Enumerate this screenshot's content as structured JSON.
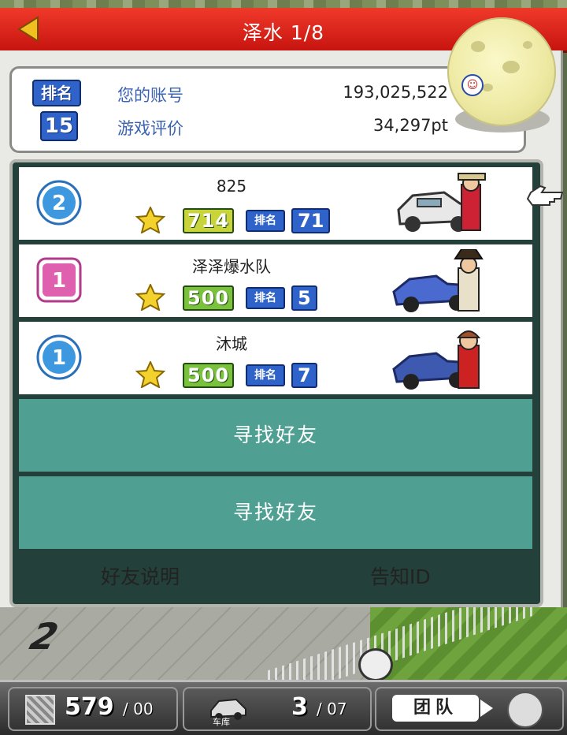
{
  "header": {
    "title": "泽水 1/8"
  },
  "account": {
    "rank_label": "排名",
    "rank_value": "15",
    "account_label": "您的账号",
    "account_value": "193,025,522",
    "eval_label": "游戏评价",
    "eval_value": "34,297pt"
  },
  "friends": [
    {
      "badge": "2",
      "badge_style": "blue-circle",
      "name": "825",
      "points": "714",
      "rank_label": "排名",
      "rank": "71"
    },
    {
      "badge": "1",
      "badge_style": "pink-square",
      "name": "泽泽爆水队",
      "points": "500",
      "rank_label": "排名",
      "rank": "5"
    },
    {
      "badge": "1",
      "badge_style": "blue-circle",
      "name": "沐城",
      "points": "500",
      "rank_label": "排名",
      "rank": "7"
    }
  ],
  "find_buttons": [
    {
      "label": "寻找好友"
    },
    {
      "label": "寻找好友"
    }
  ],
  "links": {
    "friend_help": "好友说明",
    "notify_id": "告知ID"
  },
  "statusbar": {
    "tiles_value": "579",
    "tiles_max": "/ 00",
    "garage_label": "车库",
    "garage_value": "3",
    "garage_max": "/ 07",
    "team_label": "团队"
  },
  "colors": {
    "header_red": "#e5261c",
    "panel_bg": "#e9e9e6",
    "list_bg": "#23403a",
    "find_button": "#4fa092",
    "account_text_blue": "#3b63b0"
  },
  "icons": [
    "back-arrow-icon",
    "account-face-icon",
    "star-icon",
    "moon-icon",
    "car-icon",
    "pointer-hand-icon",
    "tile-icon",
    "garage-car-icon",
    "team-face-icon"
  ]
}
